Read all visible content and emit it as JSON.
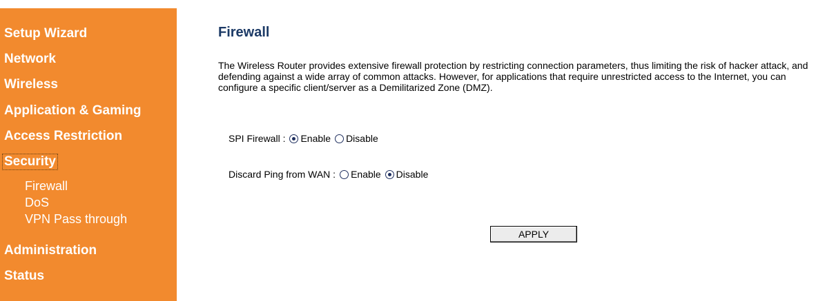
{
  "sidebar": {
    "items": [
      {
        "label": "Setup Wizard"
      },
      {
        "label": "Network"
      },
      {
        "label": "Wireless"
      },
      {
        "label": "Application & Gaming"
      },
      {
        "label": "Access Restriction"
      },
      {
        "label": "Security",
        "active": true
      },
      {
        "label": "Administration"
      },
      {
        "label": "Status"
      }
    ],
    "security_subitems": [
      {
        "label": "Firewall"
      },
      {
        "label": "DoS"
      },
      {
        "label": "VPN Pass through"
      }
    ]
  },
  "main": {
    "title": "Firewall",
    "description": "The Wireless Router provides extensive firewall protection by restricting connection parameters, thus limiting the risk of hacker attack, and defending against a wide array of common attacks. However, for applications that require unrestricted access to the Internet, you can configure a specific client/server as a Demilitarized Zone (DMZ).",
    "spi_firewall": {
      "label": "SPI Firewall :",
      "enable_label": "Enable",
      "disable_label": "Disable",
      "selected": "Enable"
    },
    "discard_ping": {
      "label": "Discard Ping from WAN :",
      "enable_label": "Enable",
      "disable_label": "Disable",
      "selected": "Disable"
    },
    "apply_label": "APPLY"
  },
  "colors": {
    "sidebar_bg": "#f28a2e",
    "title_color": "#1c3a66"
  }
}
